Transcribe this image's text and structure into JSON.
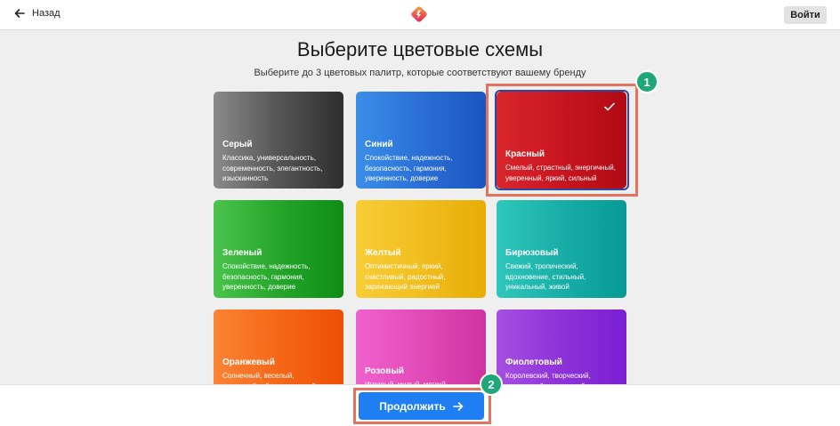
{
  "header": {
    "back_label": "Назад",
    "login_label": "Войти"
  },
  "title": "Выберите цветовые схемы",
  "subtitle": "Выберите до 3 цветовых палитр, которые соответствуют вашему бренду",
  "palettes": [
    {
      "name": "Серый",
      "desc": "Классика, универсальность, современность, элегантность, изысканность"
    },
    {
      "name": "Синий",
      "desc": "Спокойствие, надежность, безопасность, гармония, уверенность, доверие"
    },
    {
      "name": "Красный",
      "desc": "Смелый, страстный, энергичный, уверенный, яркий, сильный",
      "selected": true
    },
    {
      "name": "Зеленый",
      "desc": "Спокойствие, надежность, безопасность, гармония, уверенность, доверие"
    },
    {
      "name": "Желтый",
      "desc": "Оптимистичный, яркий, счастливый, радостный, заряжающий энергией"
    },
    {
      "name": "Бирюзовый",
      "desc": "Свежий, тропический, вдохновение, стильный, уникальный, живой"
    },
    {
      "name": "Оранжевый",
      "desc": "Солнечный, веселый, дружелюбный, молодежный"
    },
    {
      "name": "Розовый",
      "desc": "Игривый, милый, мягкий"
    },
    {
      "name": "Фиолетовый",
      "desc": "Королевский, творческий, загадочный, роскошный"
    }
  ],
  "annotations": {
    "badge_1": "1",
    "badge_2": "2"
  },
  "footer": {
    "continue_label": "Продолжить"
  },
  "colors": {
    "accent": "#1f7ef1",
    "annotation_outline": "#e4725e",
    "annotation_badge": "#20a779",
    "selection_border": "#2b47a8"
  }
}
